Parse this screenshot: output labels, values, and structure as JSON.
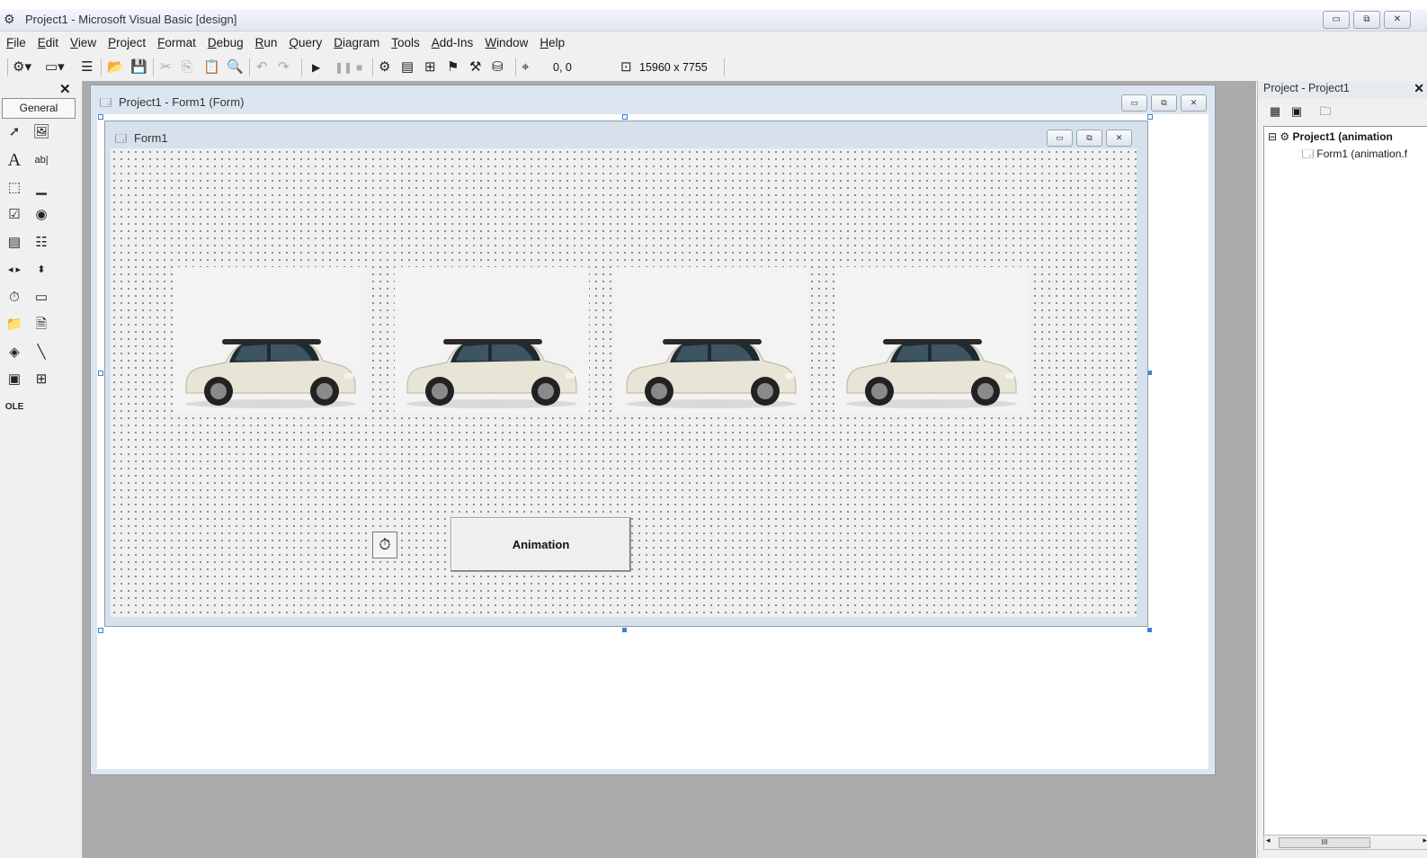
{
  "app": {
    "title": "Project1 - Microsoft Visual Basic [design]",
    "title_icon": "vb-project-icon"
  },
  "window_controls": {
    "minimize": "▭",
    "restore": "⧉",
    "close": "✕"
  },
  "menu": [
    "File",
    "Edit",
    "View",
    "Project",
    "Format",
    "Debug",
    "Run",
    "Query",
    "Diagram",
    "Tools",
    "Add-Ins",
    "Window",
    "Help"
  ],
  "toolbar": {
    "position_readout": "0, 0",
    "size_readout": "15960 x 7755",
    "icons": [
      "add-project-icon",
      "add-form-icon",
      "menu-editor-icon",
      "open-icon",
      "save-icon",
      "cut-icon",
      "copy-icon",
      "paste-icon",
      "find-icon",
      "undo-icon",
      "redo-icon",
      "run-icon",
      "break-icon",
      "end-icon",
      "project-explorer-icon",
      "properties-icon",
      "form-layout-icon",
      "object-browser-icon",
      "toolbox-icon",
      "data-view-icon",
      "position-icon",
      "size-icon"
    ]
  },
  "toolbox": {
    "tab_label": "General",
    "close_glyph": "✕",
    "tools": [
      "pointer",
      "picturebox",
      "label",
      "textbox",
      "frame",
      "commandbutton",
      "checkbox",
      "optionbutton",
      "combobox",
      "listbox",
      "hscrollbar",
      "vscrollbar",
      "timer",
      "drivelistbox",
      "dirlistbox",
      "filelistbox",
      "shape",
      "line",
      "image",
      "data",
      "ole"
    ]
  },
  "designer_window": {
    "title": "Project1 - Form1 (Form)"
  },
  "form1": {
    "title": "Form1",
    "pictures": [
      "car-image",
      "car-image",
      "car-image",
      "car-image"
    ],
    "button_caption": "Animation",
    "timer_control": "timer-icon"
  },
  "project_explorer": {
    "title": "Project - Project1",
    "close_glyph": "✕",
    "tree": [
      {
        "label": "Project1 (animation",
        "level": 0,
        "bold": true,
        "expander": "⊟"
      },
      {
        "label": "Form1 (animation.f",
        "level": 1,
        "bold": false
      }
    ],
    "scroll_thumb": "III"
  }
}
